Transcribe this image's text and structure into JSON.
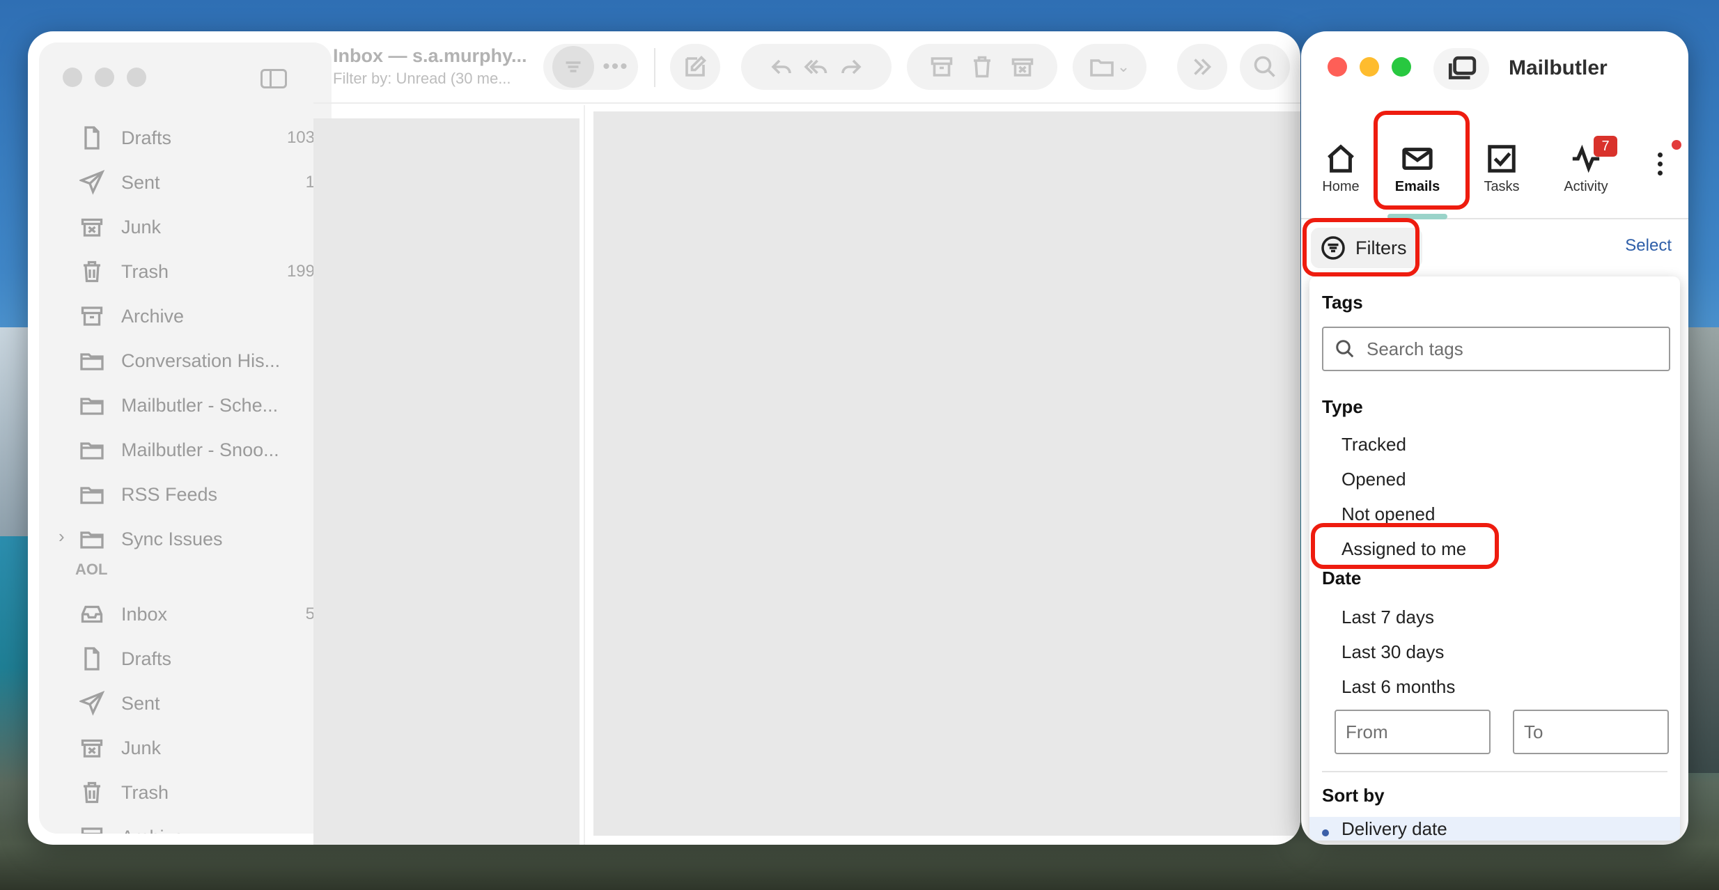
{
  "mail": {
    "title": "Inbox — s.a.murphy...",
    "subtitle": "Filter by: Unread (30 me...",
    "folders_top": [
      {
        "label": "Drafts",
        "count": "103",
        "icon": "document-icon"
      },
      {
        "label": "Sent",
        "count": "1",
        "icon": "paper-plane-icon"
      },
      {
        "label": "Junk",
        "count": "",
        "icon": "junk-icon"
      },
      {
        "label": "Trash",
        "count": "199",
        "icon": "trash-icon"
      },
      {
        "label": "Archive",
        "count": "",
        "icon": "archive-icon"
      },
      {
        "label": "Conversation His...",
        "count": "",
        "icon": "folder-icon"
      },
      {
        "label": "Mailbutler - Sche...",
        "count": "",
        "icon": "folder-icon"
      },
      {
        "label": "Mailbutler - Snoo...",
        "count": "",
        "icon": "folder-icon"
      },
      {
        "label": "RSS Feeds",
        "count": "",
        "icon": "folder-icon"
      },
      {
        "label": "Sync Issues",
        "count": "",
        "icon": "folder-icon"
      }
    ],
    "section_label": "AOL",
    "folders_aol": [
      {
        "label": "Inbox",
        "count": "5",
        "icon": "inbox-icon"
      },
      {
        "label": "Drafts",
        "count": "",
        "icon": "document-icon"
      },
      {
        "label": "Sent",
        "count": "",
        "icon": "paper-plane-icon"
      },
      {
        "label": "Junk",
        "count": "",
        "icon": "junk-icon"
      },
      {
        "label": "Trash",
        "count": "",
        "icon": "trash-icon"
      },
      {
        "label": "Archive",
        "count": "",
        "icon": "archive-icon"
      }
    ]
  },
  "mailbutler": {
    "title": "Mailbutler",
    "nav": {
      "home": "Home",
      "emails": "Emails",
      "tasks": "Tasks",
      "activity": "Activity",
      "activity_badge": "7"
    },
    "filters_label": "Filters",
    "select_label": "Select",
    "dropdown": {
      "tags_heading": "Tags",
      "search_placeholder": "Search tags",
      "type_heading": "Type",
      "type_options": [
        "Tracked",
        "Opened",
        "Not opened",
        "Assigned to me"
      ],
      "date_heading": "Date",
      "date_options": [
        "Last 7 days",
        "Last 30 days",
        "Last 6 months"
      ],
      "from_placeholder": "From",
      "to_placeholder": "To",
      "sort_heading": "Sort by",
      "sort_selected": "Delivery date"
    }
  },
  "colors": {
    "highlight": "#ee1c0f",
    "accent_link": "#2e5ea8",
    "badge": "#d9322b"
  }
}
